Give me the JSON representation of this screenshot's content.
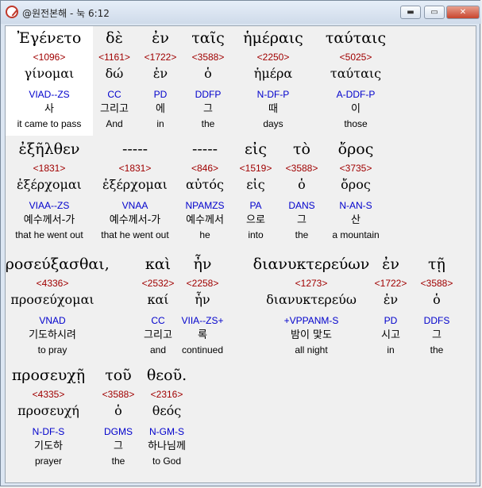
{
  "window": {
    "title": "@원전본해 - 눅 6:12",
    "minimize_label": "▬",
    "maximize_label": "▭",
    "close_label": "✕",
    "icon": "app-icon"
  },
  "rows": [
    [
      {
        "greek": "Ἐγένετο",
        "strongs": "<1096>",
        "lemma": "γίνομαι",
        "parsing": "VIAD--ZS",
        "korean": "사",
        "english": "it came to pass"
      },
      {
        "greek": "δὲ",
        "strongs": "<1161>",
        "lemma": "δώ",
        "parsing": "CC",
        "korean": "그리고",
        "english": "And"
      },
      {
        "greek": "ἐν",
        "strongs": "<1722>",
        "lemma": "ἐν",
        "parsing": "PD",
        "korean": "에",
        "english": "in"
      },
      {
        "greek": "ταῖς",
        "strongs": "<3588>",
        "lemma": "ὁ",
        "parsing": "DDFP",
        "korean": "그",
        "english": "the"
      },
      {
        "greek": "ἡμέραις",
        "strongs": "<2250>",
        "lemma": "ἡμέρα",
        "parsing": "N-DF-P",
        "korean": "때",
        "english": "days"
      },
      {
        "greek": "ταύταις",
        "strongs": "<5025>",
        "lemma": "ταύταις",
        "parsing": "A-DDF-P",
        "korean": "이",
        "english": "those"
      }
    ],
    [
      {
        "greek": "ἐξῆλθεν",
        "strongs": "<1831>",
        "lemma": "ἐξέρχομαι",
        "parsing": "VIAA--ZS",
        "korean": "예수께서-가",
        "english": "that he went out"
      },
      {
        "greek": "-----",
        "strongs": "<1831>",
        "lemma": "ἐξέρχομαι",
        "parsing": "VNAA",
        "korean": "예수께서-가",
        "english": "that he went out"
      },
      {
        "greek": "-----",
        "strongs": "<846>",
        "lemma": "αὐτός",
        "parsing": "NPAMZS",
        "korean": "예수께서",
        "english": "he"
      },
      {
        "greek": "εἰς",
        "strongs": "<1519>",
        "lemma": "εἰς",
        "parsing": "PA",
        "korean": "으로",
        "english": "into"
      },
      {
        "greek": "τὸ",
        "strongs": "<3588>",
        "lemma": "ὁ",
        "parsing": "DANS",
        "korean": "그",
        "english": "the"
      },
      {
        "greek": "ὄρος",
        "strongs": "<3735>",
        "lemma": "ὄρος",
        "parsing": "N-AN-S",
        "korean": "산",
        "english": "a mountain"
      }
    ],
    [
      {
        "greek": "προσεύξασθαι,",
        "strongs": "<4336>",
        "lemma": "προσεύχομαι",
        "parsing": "VNAD",
        "korean": "기도하시려",
        "english": "to pray"
      },
      {
        "greek": "καὶ",
        "strongs": "<2532>",
        "lemma": "καί",
        "parsing": "CC",
        "korean": "그리고",
        "english": "and"
      },
      {
        "greek": "ἦν",
        "strongs": "<2258>",
        "lemma": "ἦν",
        "parsing": "VIIA--ZS+",
        "korean": "록",
        "english": "continued"
      },
      {
        "greek": "διανυκτερεύων",
        "strongs": "<1273>",
        "lemma": "διανυκτερεύω",
        "parsing": "+VPPANM-S",
        "korean": "밤이 맟도",
        "english": "all night"
      },
      {
        "greek": "ἐν",
        "strongs": "<1722>",
        "lemma": "ἐν",
        "parsing": "PD",
        "korean": "시고",
        "english": "in"
      },
      {
        "greek": "τῇ",
        "strongs": "<3588>",
        "lemma": "ὁ",
        "parsing": "DDFS",
        "korean": "그",
        "english": "the"
      }
    ],
    [
      {
        "greek": "προσευχῇ",
        "strongs": "<4335>",
        "lemma": "προσευχή",
        "parsing": "N-DF-S",
        "korean": "기도하",
        "english": "prayer"
      },
      {
        "greek": "τοῦ",
        "strongs": "<3588>",
        "lemma": "ὁ",
        "parsing": "DGMS",
        "korean": "그",
        "english": "the"
      },
      {
        "greek": "θεοῦ.",
        "strongs": "<2316>",
        "lemma": "θεός",
        "parsing": "N-GM-S",
        "korean": "하나님께",
        "english": "to God"
      }
    ]
  ]
}
